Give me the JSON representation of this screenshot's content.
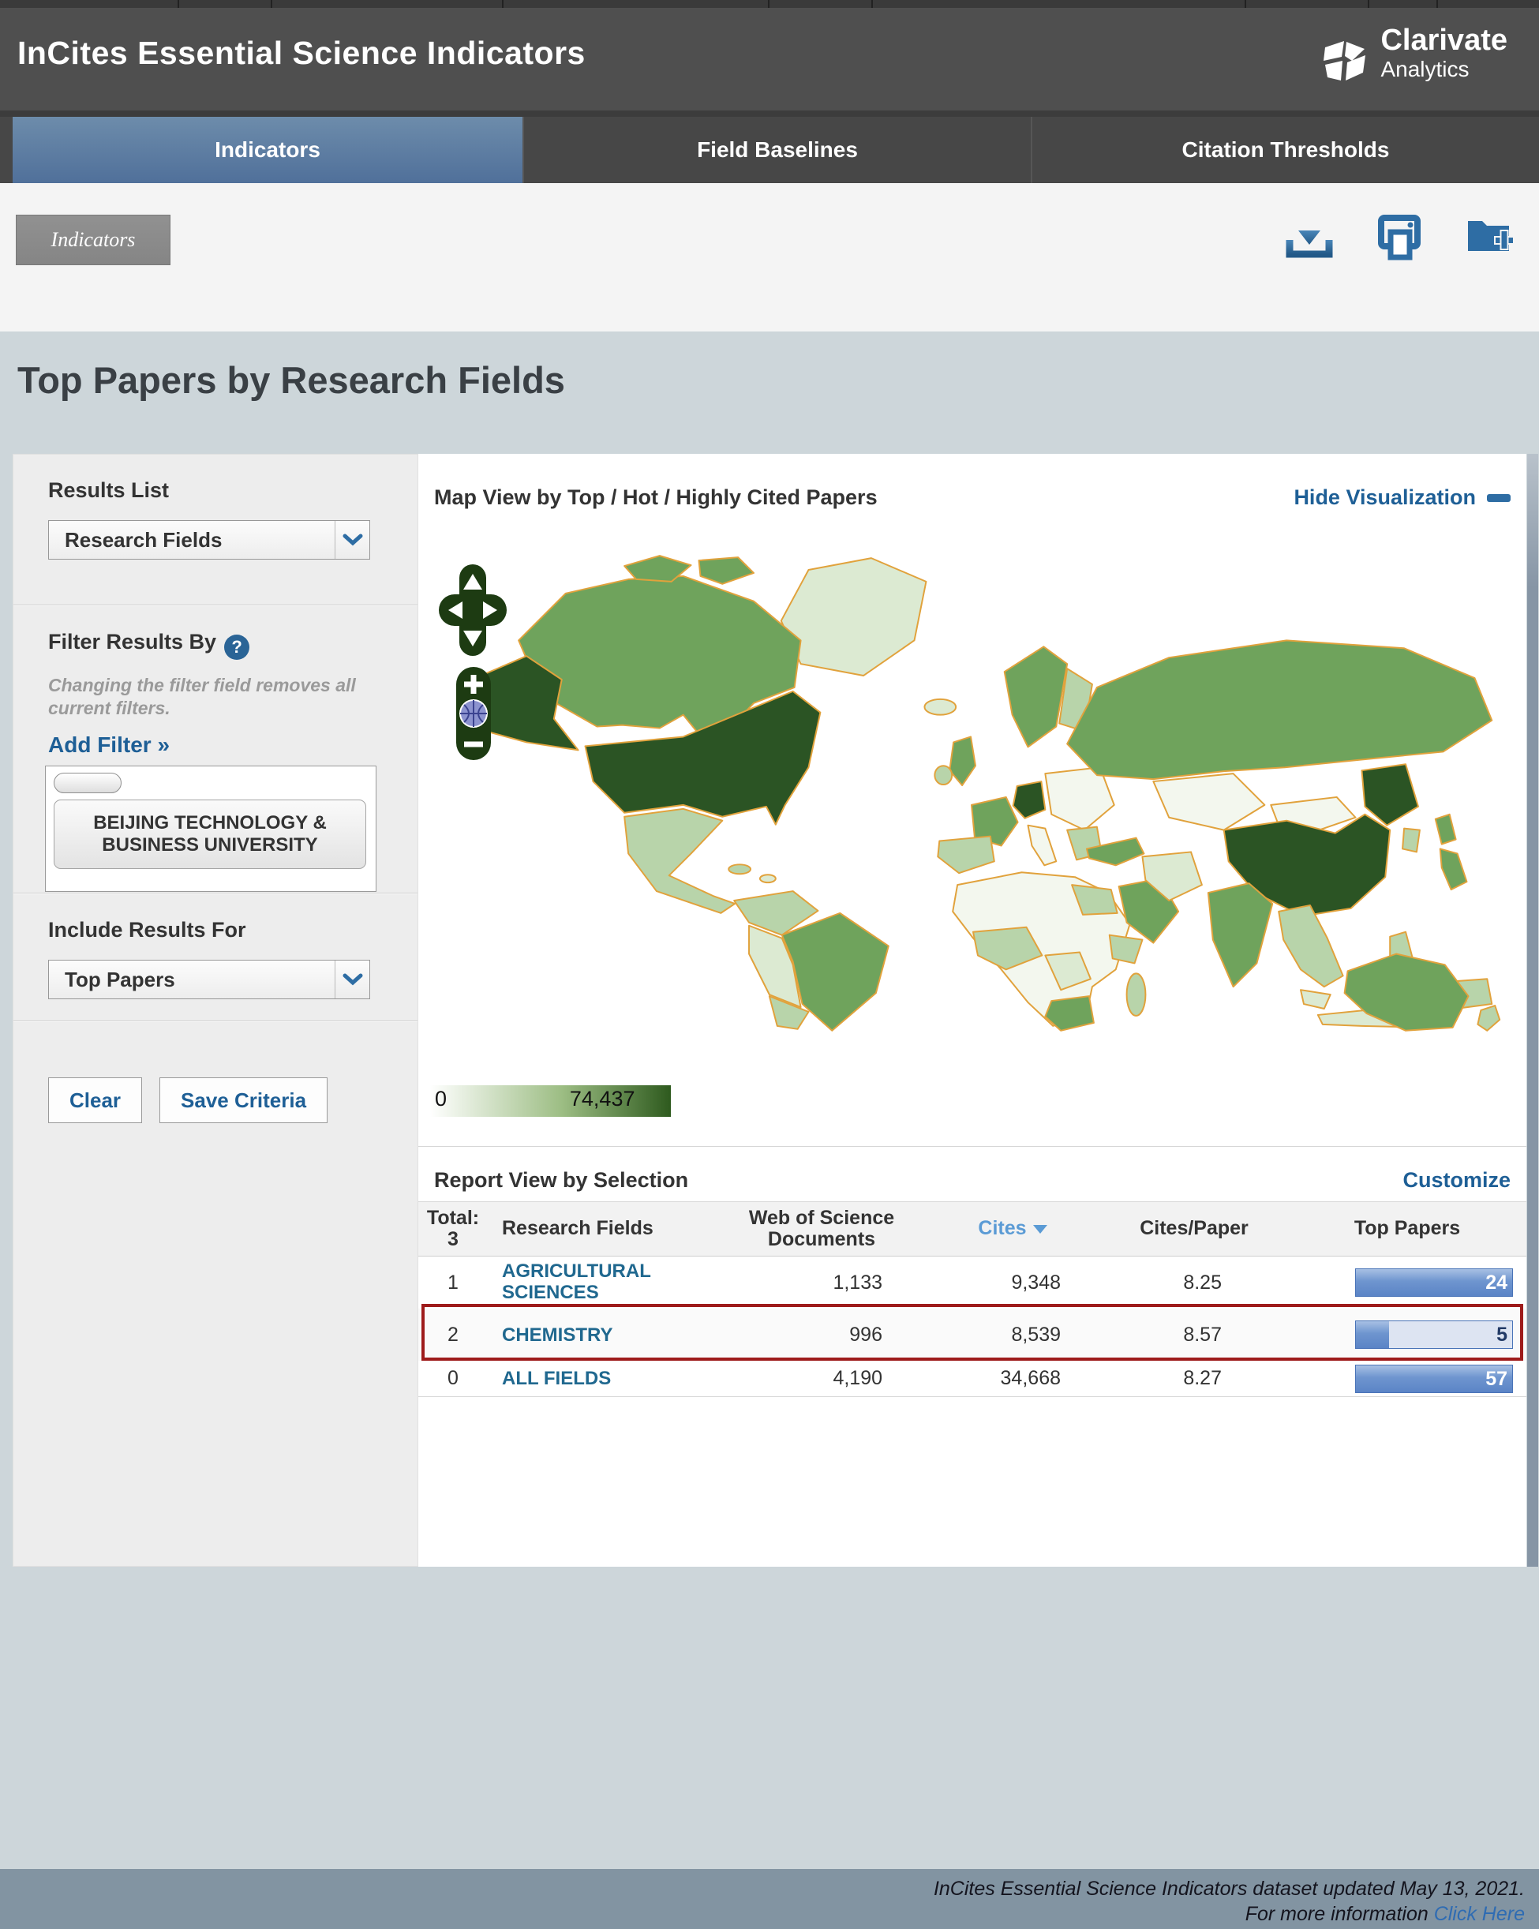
{
  "header": {
    "title": "InCites Essential Science Indicators",
    "brand": {
      "name": "Clarivate",
      "sub": "Analytics",
      "logo_icon": "clarivate-mark-icon"
    }
  },
  "tabs": [
    {
      "label": "Indicators",
      "active": true
    },
    {
      "label": "Field Baselines",
      "active": false
    },
    {
      "label": "Citation Thresholds",
      "active": false
    }
  ],
  "toolbar": {
    "breadcrumb": "Indicators",
    "icons": [
      "download-icon",
      "print-icon",
      "folder-add-icon"
    ]
  },
  "page": {
    "title": "Top Papers by Research Fields"
  },
  "sidebar": {
    "results_list": {
      "heading": "Results List",
      "selected": "Research Fields"
    },
    "filter": {
      "heading": "Filter Results By",
      "help_icon": "?",
      "note": "Changing the filter field removes all current filters.",
      "add_filter": "Add Filter »",
      "active_filter": "BEIJING TECHNOLOGY & BUSINESS UNIVERSITY"
    },
    "include": {
      "heading": "Include Results For",
      "selected": "Top Papers"
    },
    "buttons": {
      "clear": "Clear",
      "save": "Save Criteria"
    }
  },
  "map": {
    "title": "Map View by Top / Hot / Highly Cited Papers",
    "hide_link": "Hide Visualization",
    "scale": {
      "min": "0",
      "max": "74,437"
    },
    "palette": {
      "none": "#f3f7ee",
      "low": "#dcead2",
      "medium": "#b8d4aa",
      "high": "#6fa35c",
      "very_high": "#3a6b2c",
      "max": "#2b5424",
      "border": "#e1a23c"
    },
    "controls": [
      "pan-up-icon",
      "pan-left-icon",
      "pan-right-icon",
      "pan-down-icon",
      "zoom-in-icon",
      "globe-icon",
      "zoom-out-icon"
    ]
  },
  "report": {
    "title": "Report View by Selection",
    "customize": "Customize",
    "table": {
      "total_label": "Total:",
      "total_value": "3",
      "columns": {
        "field": "Research Fields",
        "docs_line1": "Web of Science",
        "docs_line2": "Documents",
        "cites": "Cites",
        "cites_per_paper": "Cites/Paper",
        "top_papers": "Top Papers"
      },
      "sorted_column": "Cites",
      "rows": [
        {
          "rank": "1",
          "field": "AGRICULTURAL SCIENCES",
          "docs": "1,133",
          "cites": "9,348",
          "cites_per_paper": "8.25",
          "top_papers": "24",
          "bar_pct": 100,
          "highlighted": false
        },
        {
          "rank": "2",
          "field": "CHEMISTRY",
          "docs": "996",
          "cites": "8,539",
          "cites_per_paper": "8.57",
          "top_papers": "5",
          "bar_pct": 21,
          "highlighted": true
        },
        {
          "rank": "0",
          "field": "ALL FIELDS",
          "docs": "4,190",
          "cites": "34,668",
          "cites_per_paper": "8.27",
          "top_papers": "57",
          "bar_pct": 100,
          "highlighted": false
        }
      ]
    }
  },
  "footer": {
    "line1": "InCites Essential Science Indicators dataset updated May 13, 2021.",
    "line2_prefix": "For more information ",
    "link": "Click Here"
  }
}
